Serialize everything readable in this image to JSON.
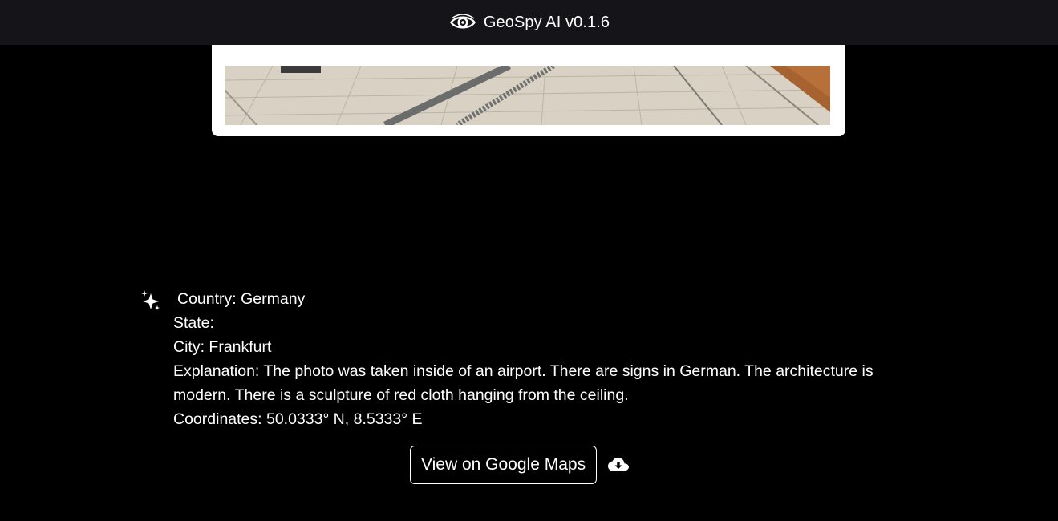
{
  "header": {
    "logo_icon": "eye-icon",
    "title": "GeoSpy AI v0.1.6"
  },
  "photo": {
    "description_icon": "uploaded-photo"
  },
  "result": {
    "icon": "sparkle-icon",
    "country": "Country: Germany",
    "state": "State:",
    "city": "City: Frankfurt",
    "explanation": "Explanation: The photo was taken inside of an airport. There are signs in German. The architecture is modern. There is a sculpture of red cloth hanging from the ceiling.",
    "coordinates": "Coordinates: 50.0333° N, 8.5333° E"
  },
  "actions": {
    "maps_label": "View on Google Maps",
    "download_icon": "cloud-download-icon"
  },
  "colors": {
    "background": "#000000",
    "header_bg": "#151419",
    "text": "#ffffff",
    "card": "#ffffff"
  }
}
